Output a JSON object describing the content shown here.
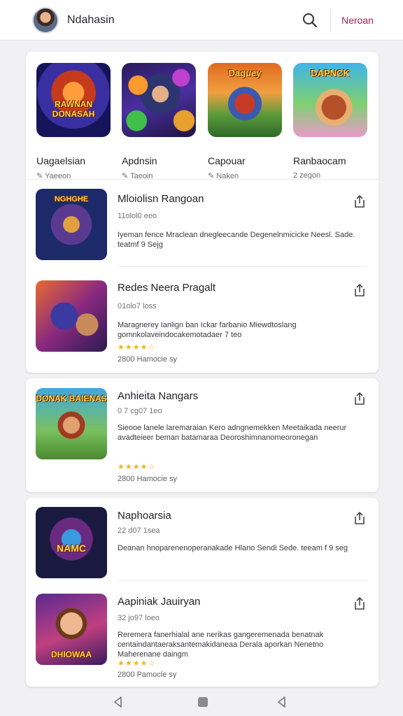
{
  "header": {
    "user_name": "Ndahasin",
    "action_link": "Neroan"
  },
  "featured": [
    {
      "name": "Uagaelsian",
      "sub": "Yaeeon",
      "art_text": "RAWNAN DONASAH"
    },
    {
      "name": "Apdnsin",
      "sub": "Taeoin",
      "art_text": ""
    },
    {
      "name": "Capouar",
      "sub": "Naken",
      "art_text": "Daguey"
    },
    {
      "name": "Ranbaocam",
      "sub": "2 zegon",
      "art_text": "DAPNCK"
    }
  ],
  "games": [
    {
      "title": "Mloiolisn Rangoan",
      "meta": "11olol0 eeo",
      "desc": "Iyeman fence Mraclean dnegleecande Degenelnmicicke Neesl. Sade. teatmf 9 Sejg",
      "stars": "",
      "foot": "",
      "art_text": "NGHGHE"
    },
    {
      "title": "Redes Neera Pragalt",
      "meta": "01olo7 loss",
      "desc": "Maragnerey Ianlign ban Ickar farbanio Miewdtoslang gomnkolaveindocakemotadaer 7 teo",
      "stars": "★★★★☆",
      "foot": "2800 Hamocie sy",
      "art_text": ""
    },
    {
      "title": "Anhieita Nangars",
      "meta": "0 7 cg07 1eo",
      "desc": "Sieooe lanele laremaraian Kero adngnemekken Meetaikada neerur avadteieer beman batamaraa Deoroshimnanomeoronegan",
      "stars": "★★★★☆",
      "foot": "2800 Hamocie sy",
      "art_text": "DONAK BAIENAS"
    },
    {
      "title": "Naphoarsia",
      "meta": "22 d07 1sea",
      "desc": "Deanan hnoparenenoperanakade Hlano Sendi Sede. teeam f 9 seg",
      "stars": "",
      "foot": "",
      "art_text": "NAMC"
    },
    {
      "title": "Aapiniak Jauiryan",
      "meta": "32 jo97 loeo",
      "desc": "Reremera fanerhialal ane nerikas gangeremenada benatnak centaindantaeraksantemakidaneaa Derala aporkan Nenetno Maherenane daingm",
      "stars": "★★★★☆",
      "foot": "2800 Pamocle sy",
      "art_text": "DHIOWAA"
    }
  ],
  "colors": {
    "accent": "#a1255a",
    "star": "#f0b428"
  }
}
